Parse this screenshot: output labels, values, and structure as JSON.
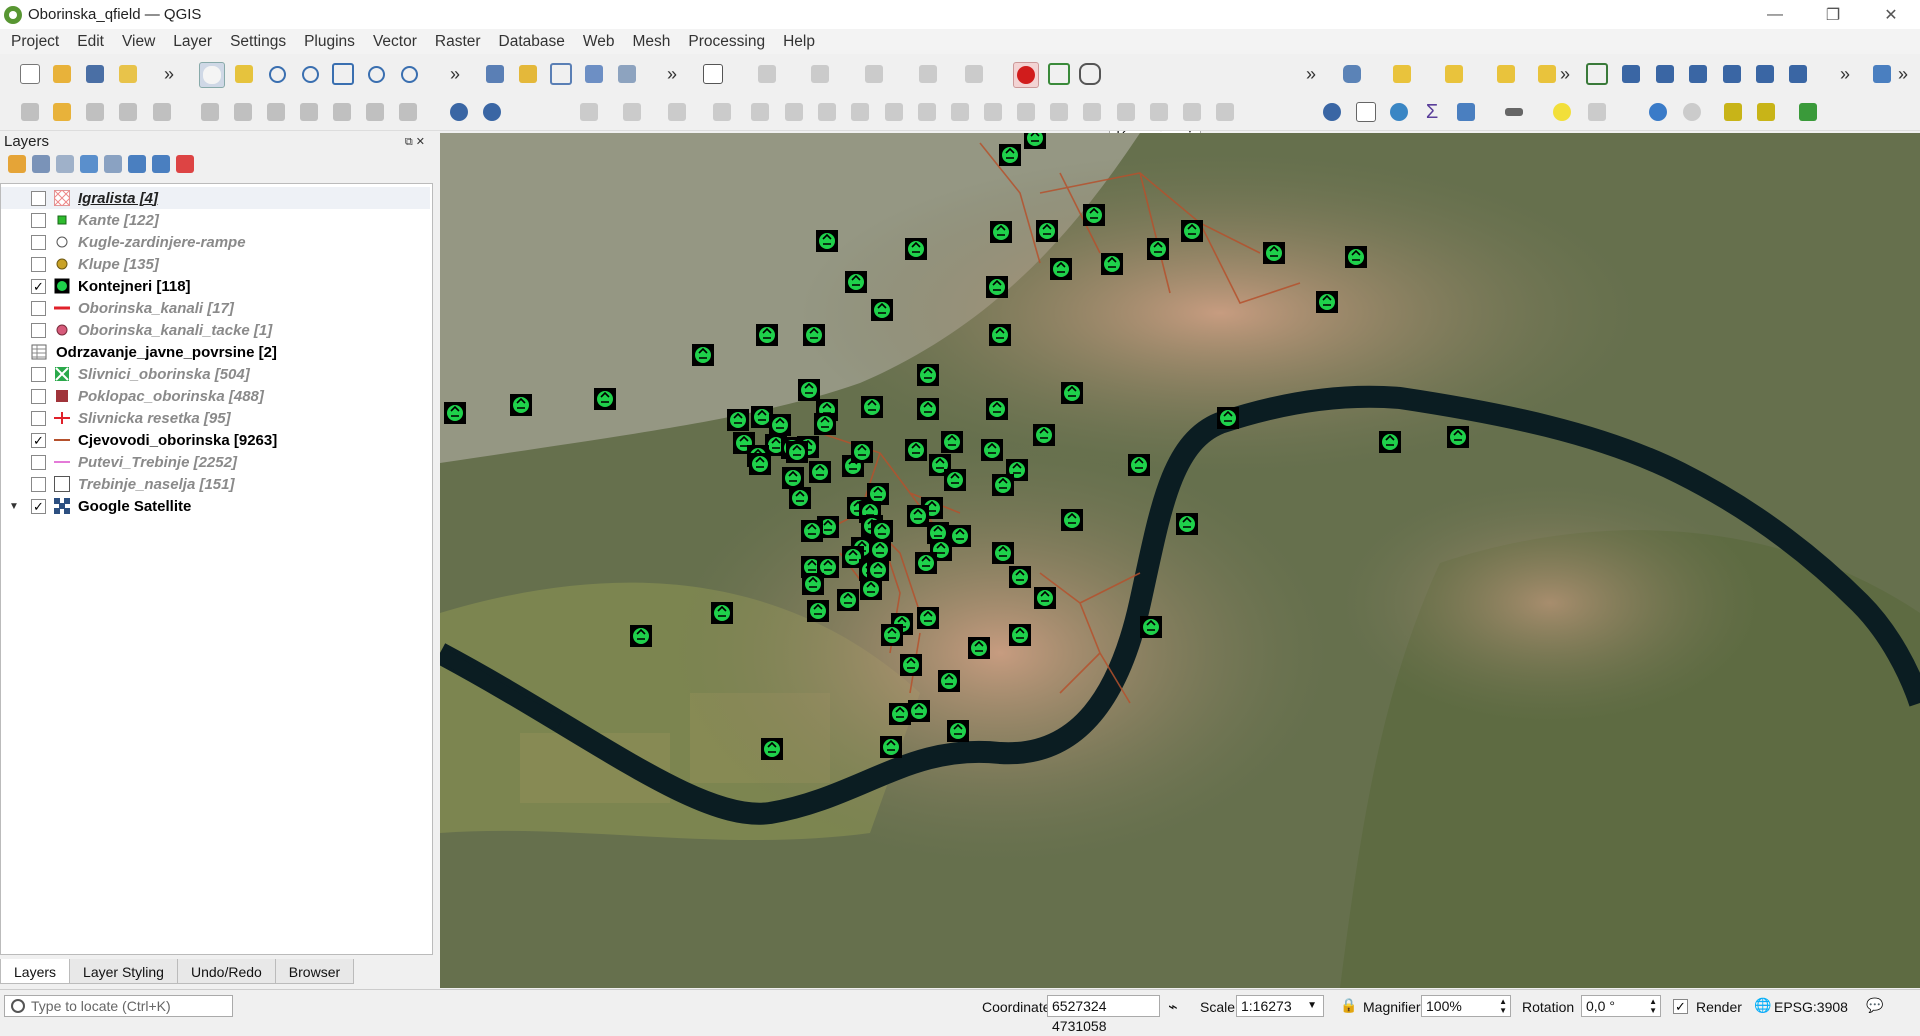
{
  "window": {
    "title": "Oborinska_qfield — QGIS",
    "controls": [
      "—",
      "❐",
      "✕"
    ]
  },
  "menu": [
    "Project",
    "Edit",
    "View",
    "Layer",
    "Settings",
    "Plugins",
    "Vector",
    "Raster",
    "Database",
    "Web",
    "Mesh",
    "Processing",
    "Help"
  ],
  "toolbar": {
    "scale_value": "12",
    "more": "»"
  },
  "layers_panel": {
    "title": "Layers",
    "layers": [
      {
        "name": "Igralista [4]",
        "checked": false,
        "style": "under",
        "symbol": "hatch"
      },
      {
        "name": "Kante [122]",
        "checked": false,
        "style": "off",
        "symbol": "green-square"
      },
      {
        "name": "Kugle-zardinjere-rampe",
        "checked": false,
        "style": "off",
        "symbol": "white-circle"
      },
      {
        "name": "Klupe [135]",
        "checked": false,
        "style": "off",
        "symbol": "yellow-circle"
      },
      {
        "name": "Kontejneri [118]",
        "checked": true,
        "style": "on",
        "symbol": "recycle"
      },
      {
        "name": "Oborinska_kanali [17]",
        "checked": false,
        "style": "off",
        "symbol": "red-line"
      },
      {
        "name": "Oborinska_kanali_tacke [1]",
        "checked": false,
        "style": "off",
        "symbol": "pink-circle"
      },
      {
        "name": "Odrzavanje_javne_povrsine [2]",
        "checked": null,
        "style": "on",
        "symbol": "table"
      },
      {
        "name": "Slivnici_oborinska [504]",
        "checked": false,
        "style": "off",
        "symbol": "green-x"
      },
      {
        "name": "Poklopac_oborinska [488]",
        "checked": false,
        "style": "off",
        "symbol": "brown-square"
      },
      {
        "name": "Slivnicka resetka [95]",
        "checked": false,
        "style": "off",
        "symbol": "red-cross"
      },
      {
        "name": "Cjevovodi_oborinska [9263]",
        "checked": true,
        "style": "on",
        "symbol": "brown-line"
      },
      {
        "name": "Putevi_Trebinje [2252]",
        "checked": false,
        "style": "off",
        "symbol": "pink-line"
      },
      {
        "name": "Trebinje_naselja [151]",
        "checked": false,
        "style": "off",
        "symbol": "empty-square"
      },
      {
        "name": "Google Satellite",
        "checked": true,
        "style": "on",
        "symbol": "raster"
      }
    ],
    "tabs": [
      "Layers",
      "Layer Styling",
      "Undo/Redo",
      "Browser"
    ]
  },
  "statusbar": {
    "locate_placeholder": "Type to locate (Ctrl+K)",
    "coordinate_label": "Coordinate",
    "coordinate_value": "6527324 4731058",
    "scale_label": "Scale",
    "scale_value": "1:16273",
    "magnifier_label": "Magnifier",
    "magnifier_value": "100%",
    "rotation_label": "Rotation",
    "rotation_value": "0,0 °",
    "render_label": "Render",
    "crs": "EPSG:3908"
  },
  "colors": {
    "accent": "#589632",
    "container": "#1fd14b",
    "pipe": "#b5512d",
    "river": "#0b1d22"
  }
}
